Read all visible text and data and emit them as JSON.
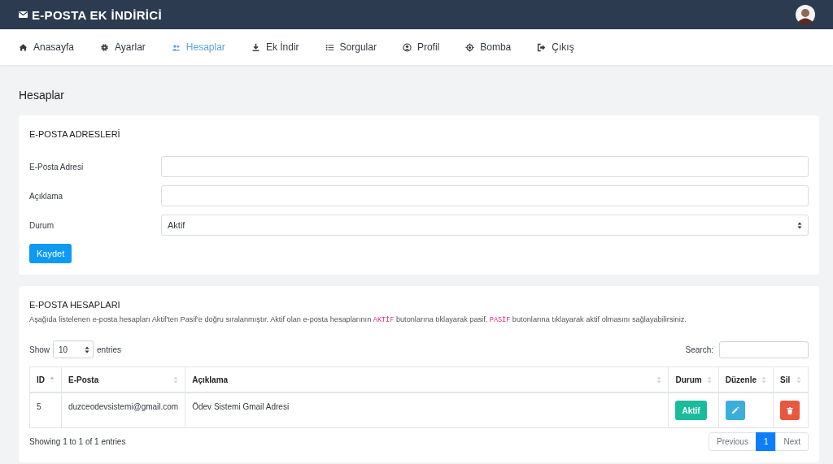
{
  "header": {
    "title": "E-POSTA EK İNDİRİCİ"
  },
  "nav": [
    {
      "label": "Anasayfa",
      "selected": false
    },
    {
      "label": "Ayarlar",
      "selected": false
    },
    {
      "label": "Hesaplar",
      "selected": true
    },
    {
      "label": "Ek İndir",
      "selected": false
    },
    {
      "label": "Sorgular",
      "selected": false
    },
    {
      "label": "Profil",
      "selected": false
    },
    {
      "label": "Bomba",
      "selected": false
    },
    {
      "label": "Çıkış",
      "selected": false
    }
  ],
  "page_title": "Hesaplar",
  "form_card": {
    "title": "E-POSTA ADRESLERİ",
    "fields": [
      {
        "label": "E-Posta Adresi",
        "kind": "text"
      },
      {
        "label": "Açıklama",
        "kind": "text"
      },
      {
        "label": "Durum",
        "kind": "select",
        "value": "Aktif"
      }
    ],
    "submit": "Kaydet"
  },
  "table_card": {
    "title": "E-POSTA HESAPLARI",
    "description": [
      {
        "kind": "text",
        "text": "Aşağıda listelenen e-posta hesapları Aktif'ten Pasif'e doğru sıralanmıştır. Aktif olan e-posta hesaplarının "
      },
      {
        "kind": "code",
        "text": "AKTİF"
      },
      {
        "kind": "text",
        "text": " butonlarına tıklayarak pasif, "
      },
      {
        "kind": "code",
        "text": "PASİF"
      },
      {
        "kind": "text",
        "text": " butonlarına tıklayarak aktif olmasını sağlayabilirsiniz."
      }
    ],
    "length": {
      "before": "Show",
      "value": "10",
      "after": "entries"
    },
    "search": {
      "label": "Search:"
    },
    "columns": [
      {
        "label": "ID",
        "sorted": true
      },
      {
        "label": "E-Posta",
        "sorted": false
      },
      {
        "label": "Açıklama",
        "sorted": false
      },
      {
        "label": "Durum",
        "sorted": false
      },
      {
        "label": "Düzenle",
        "sorted": false
      },
      {
        "label": "Sil",
        "sorted": false
      }
    ],
    "rows": [
      {
        "cells": [
          "5",
          "duzceodevsistemi@gmail.com",
          "Ödev Sistemi Gmail Adresi"
        ],
        "status": "Aktif"
      }
    ],
    "info": "Showing 1 to 1 of 1 entries",
    "pagination": [
      {
        "label": "Previous",
        "selected": false
      },
      {
        "label": "1",
        "selected": true
      },
      {
        "label": "Next",
        "selected": false
      }
    ]
  }
}
